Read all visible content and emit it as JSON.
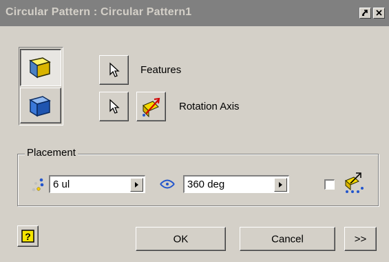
{
  "window": {
    "title": "Circular Pattern : Circular Pattern1"
  },
  "selection": {
    "features_label": "Features",
    "rotation_axis_label": "Rotation Axis"
  },
  "placement": {
    "group_label": "Placement",
    "count_value": "6 ul",
    "angle_value": "360 deg",
    "fitted_checked": false
  },
  "footer": {
    "ok_label": "OK",
    "cancel_label": "Cancel",
    "more_label": ">>"
  },
  "icons": {
    "help": "help-icon",
    "features_mode": "feature-pattern-icon",
    "solid_mode": "solid-pattern-icon",
    "select": "arrow-cursor-icon",
    "flip": "flip-direction-icon",
    "count": "occurrence-count-icon",
    "angle": "angle-icon",
    "fitted": "fitted-direction-icon"
  },
  "colors": {
    "title_bar": "#808080",
    "dialog_face": "#d4d0c8",
    "feature_yellow": "#f5d800",
    "solid_blue": "#3a78d8"
  }
}
